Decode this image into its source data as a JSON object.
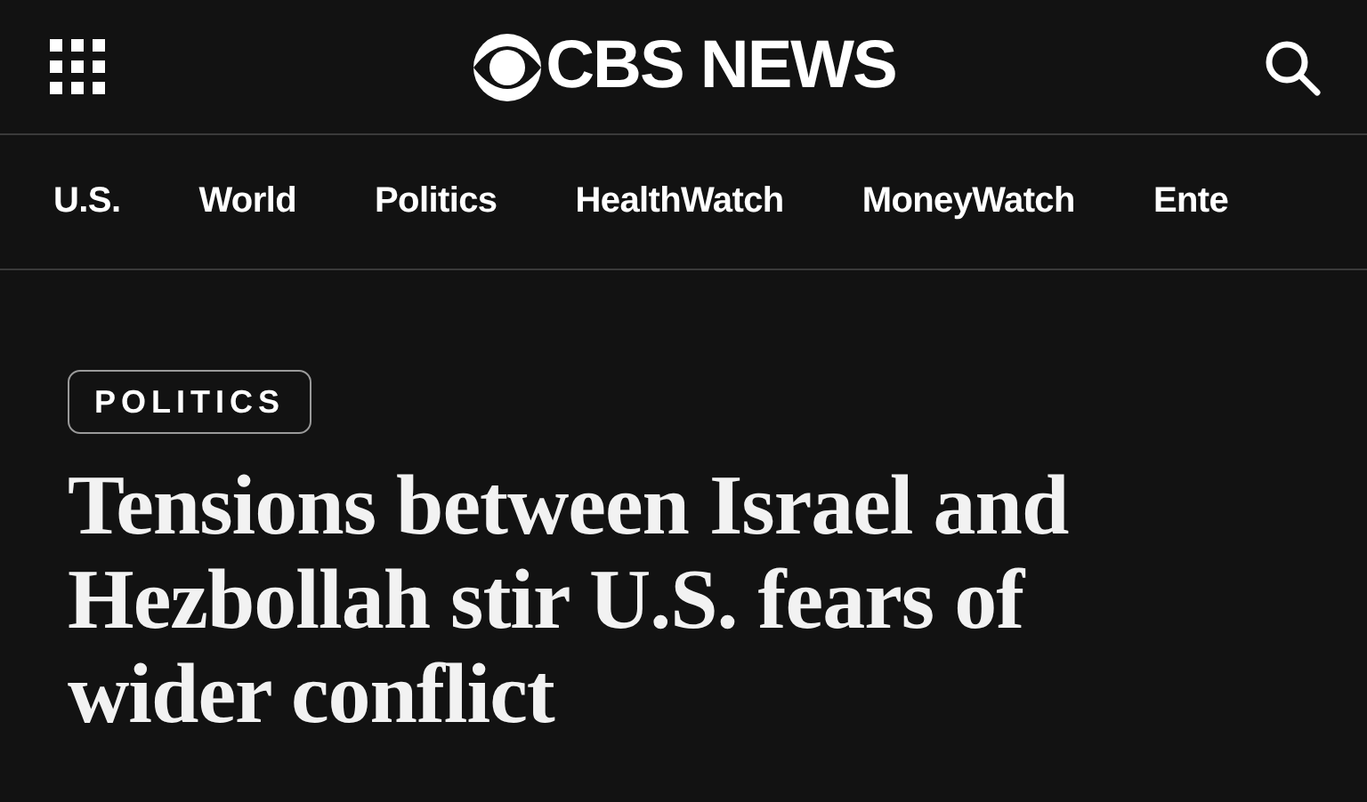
{
  "header": {
    "logo_text": "CBS NEWS"
  },
  "nav": {
    "items": [
      {
        "label": "U.S."
      },
      {
        "label": "World"
      },
      {
        "label": "Politics"
      },
      {
        "label": "HealthWatch"
      },
      {
        "label": "MoneyWatch"
      },
      {
        "label": "Ente"
      }
    ]
  },
  "article": {
    "category": "POLITICS",
    "headline": "Tensions between Israel and Hezbollah stir U.S. fears of wider conflict"
  }
}
